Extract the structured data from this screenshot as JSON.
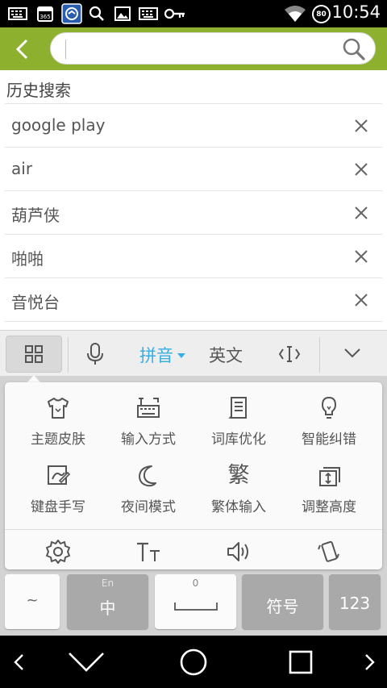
{
  "status_bar": {
    "time": "10:54",
    "battery": "80",
    "icons": [
      "keyboard-icon",
      "calendar-icon",
      "app-icon",
      "search-icon",
      "image-icon",
      "keyboard-icon",
      "key-icon",
      "wifi-icon",
      "battery-icon"
    ]
  },
  "header": {
    "search_value": "",
    "accent_color": "#8db12f"
  },
  "history": {
    "title": "历史搜索",
    "items": [
      {
        "label": "google play"
      },
      {
        "label": "air"
      },
      {
        "label": "葫芦侠"
      },
      {
        "label": "啪啪"
      },
      {
        "label": "音悦台"
      }
    ]
  },
  "ime_bar": {
    "pinyin": "拼音",
    "english": "英文",
    "active_color": "#35aee0"
  },
  "panel": {
    "items": [
      {
        "label": "主题皮肤",
        "icon": "shirt-icon"
      },
      {
        "label": "输入方式",
        "icon": "keyboard-mode-icon"
      },
      {
        "label": "词库优化",
        "icon": "dictionary-icon"
      },
      {
        "label": "智能纠错",
        "icon": "bulb-icon"
      },
      {
        "label": "键盘手写",
        "icon": "handwriting-icon"
      },
      {
        "label": "夜间模式",
        "icon": "moon-icon"
      },
      {
        "label": "繁体输入",
        "icon": "traditional-char-icon"
      },
      {
        "label": "调整高度",
        "icon": "resize-icon"
      }
    ],
    "traditional_glyph": "繁",
    "bottom_icons": [
      "settings-icon",
      "font-size-icon",
      "sound-icon",
      "vibrate-icon"
    ]
  },
  "keyboard": {
    "tilde": "~",
    "lang_sub": "En",
    "lang_main": "中",
    "space_sub": "0",
    "symbol": "符号",
    "numbers": "123"
  }
}
